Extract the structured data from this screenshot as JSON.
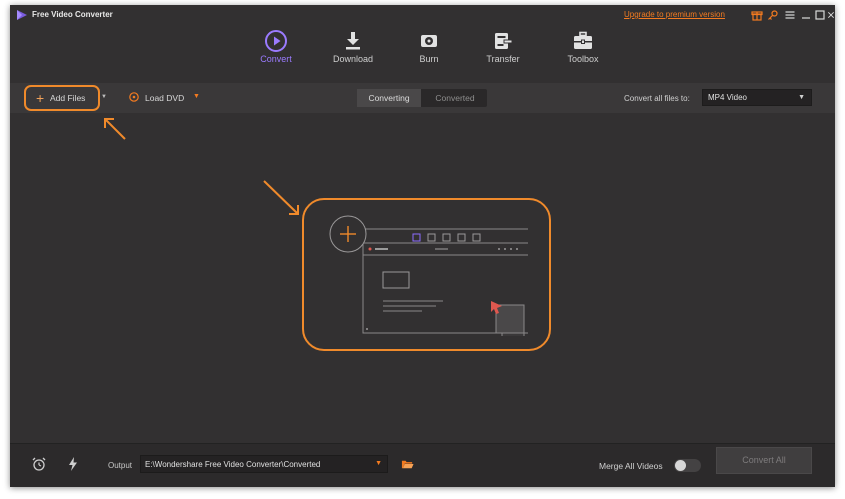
{
  "app": {
    "title": "Free Video Converter",
    "upgrade_link": "Upgrade to premium version",
    "title_icons": [
      "gift-icon",
      "key-icon",
      "menu-icon",
      "minimize-icon",
      "maximize-icon",
      "close-icon"
    ]
  },
  "nav": {
    "active": "Convert",
    "items": [
      {
        "label": "Convert",
        "icon": "convert-icon"
      },
      {
        "label": "Download",
        "icon": "download-icon"
      },
      {
        "label": "Burn",
        "icon": "burn-icon"
      },
      {
        "label": "Transfer",
        "icon": "transfer-icon"
      },
      {
        "label": "Toolbox",
        "icon": "toolbox-icon"
      }
    ]
  },
  "toolbar": {
    "add_files": "Add Files",
    "load_dvd": "Load DVD",
    "tabs": [
      "Converting",
      "Converted"
    ],
    "active_tab": "Converting",
    "convert_all_to_label": "Convert all files to:",
    "format": "MP4 Video"
  },
  "footer": {
    "output_label": "Output",
    "output_path": "E:\\Wondershare Free Video Converter\\Converted",
    "merge_label": "Merge All Videos",
    "merge_enabled": false,
    "convert_all": "Convert All"
  },
  "colors": {
    "accent": "#8e6dff",
    "highlight": "#f08a2b",
    "background": "#323031"
  }
}
